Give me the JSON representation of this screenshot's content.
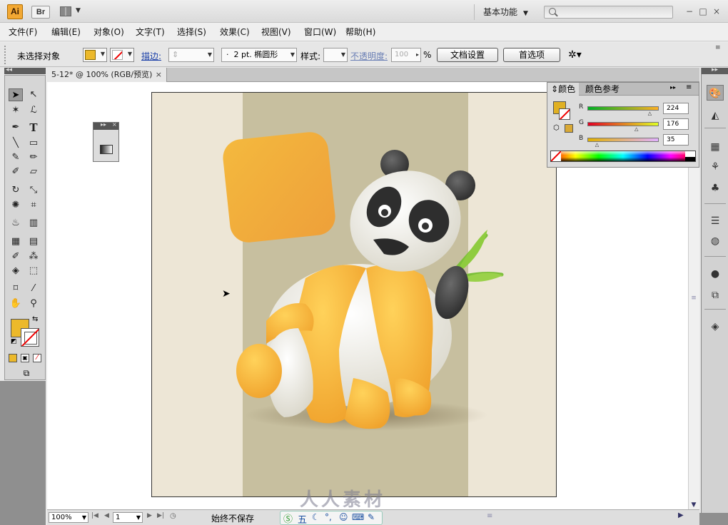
{
  "app": {
    "logo": "Ai",
    "bridge_label": "Br",
    "workspace_label": "基本功能",
    "search_placeholder": ""
  },
  "window_controls": [
    "−",
    "□",
    "×"
  ],
  "menu": [
    "文件(F)",
    "编辑(E)",
    "对象(O)",
    "文字(T)",
    "选择(S)",
    "效果(C)",
    "视图(V)",
    "窗口(W)",
    "帮助(H)"
  ],
  "controlbar": {
    "selection_status": "未选择对象",
    "stroke_label": "描边:",
    "brush_value": "2 pt. 椭圆形",
    "brush_dot": "·",
    "style_label": "样式:",
    "opacity_label": "不透明度:",
    "opacity_value": "100",
    "opacity_unit": "%",
    "doc_setup_button": "文档设置",
    "preferences_button": "首选项"
  },
  "document": {
    "tab_title": "5-12* @ 100% (RGB/预览)",
    "tab_close": "×"
  },
  "color_panel": {
    "tabs": [
      "颜色",
      "颜色参考"
    ],
    "sliders": [
      {
        "label": "R",
        "value": "224",
        "fraction": 0.878
      },
      {
        "label": "G",
        "value": "176",
        "fraction": 0.69
      },
      {
        "label": "B",
        "value": "35",
        "fraction": 0.137
      }
    ],
    "fill_color": "#e0b023"
  },
  "statusbar": {
    "zoom": "100%",
    "page": "1",
    "status": "始终不保存"
  },
  "watermark": "人人素材",
  "ime": "五"
}
